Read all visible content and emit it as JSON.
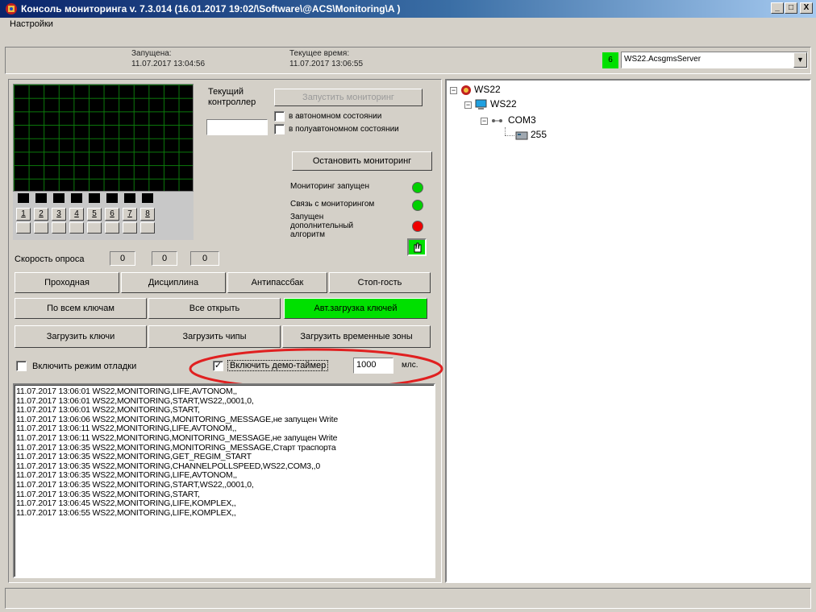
{
  "window": {
    "title": "Консоль мониторинга v. 7.3.014 (16.01.2017 19:02/\\Software\\@ACS\\Monitoring\\A )",
    "min_label": "_",
    "max_label": "□",
    "close_label": "X"
  },
  "menu": {
    "settings": "Настройки"
  },
  "header": {
    "started_label": "Запущена:",
    "started_value": "11.07.2017 13:04:56",
    "current_time_label": "Текущее время:",
    "current_time_value": "11.07.2017 13:06:55",
    "counter": "6",
    "server_select": "WS22.AcsgmsServer"
  },
  "controller": {
    "label_line1": "Текущий",
    "label_line2": "контроллер",
    "value": "",
    "start_button": "Запустить мониторинг",
    "auto_label": "в автономном состоянии",
    "semi_auto_label": "в полуавтономном состоянии",
    "stop_button": "Остановить мониторинг"
  },
  "indicators": {
    "monitoring_started": "Мониторинг запущен",
    "connection": "Связь с мониторингом",
    "extra_line1": "Запущен",
    "extra_line2": "дополнительный",
    "extra_line3": "алгоритм",
    "colors": {
      "green": "#00d000",
      "red": "#ee0000"
    }
  },
  "channels": [
    "1",
    "2",
    "3",
    "4",
    "5",
    "6",
    "7",
    "8"
  ],
  "poll_speed": {
    "label": "Скорость опроса",
    "values": [
      "0",
      "0",
      "0"
    ]
  },
  "buttons": {
    "row1": [
      "Проходная",
      "Дисциплина",
      "Антипассбак",
      "Стоп-гость"
    ],
    "row2": [
      "По всем ключам",
      "Все открыть",
      "Авт.загрузка ключей"
    ],
    "row3": [
      "Загрузить ключи",
      "Загрузить чипы",
      "Загрузить временные зоны"
    ]
  },
  "debug": {
    "debug_mode_label": "Включить режим отладки",
    "demo_timer_label": "Включить демо-таймер",
    "demo_timer_checked": "✓",
    "interval_value": "1000",
    "unit": "млс."
  },
  "log": [
    "11.07.2017 13:06:01 WS22,MONITORING,LIFE,AVTONOM,,",
    "11.07.2017 13:06:01 WS22,MONITORING,START,WS22,,0001,0,",
    "11.07.2017 13:06:01 WS22,MONITORING,START,",
    "11.07.2017 13:06:06 WS22,MONITORING,MONITORING_MESSAGE,не запущен Write",
    "11.07.2017 13:06:11 WS22,MONITORING,LIFE,AVTONOM,,",
    "11.07.2017 13:06:11 WS22,MONITORING,MONITORING_MESSAGE,не запущен Write",
    "11.07.2017 13:06:35 WS22,MONITORING,MONITORING_MESSAGE,Старт траспорта",
    "11.07.2017 13:06:35 WS22,MONITORING,GET_REGIM_START",
    "11.07.2017 13:06:35 WS22,MONITORING,CHANNELPOLLSPEED,WS22,COM3,,0",
    "11.07.2017 13:06:35 WS22,MONITORING,LIFE,AVTONOM,,",
    "11.07.2017 13:06:35 WS22,MONITORING,START,WS22,,0001,0,",
    "11.07.2017 13:06:35 WS22,MONITORING,START,",
    "11.07.2017 13:06:45 WS22,MONITORING,LIFE,KOMPLEX,,",
    "11.07.2017 13:06:55 WS22,MONITORING,LIFE,KOMPLEX,,"
  ],
  "tree": {
    "root": "WS22",
    "child": "WS22",
    "port": "COM3",
    "device": "255"
  }
}
